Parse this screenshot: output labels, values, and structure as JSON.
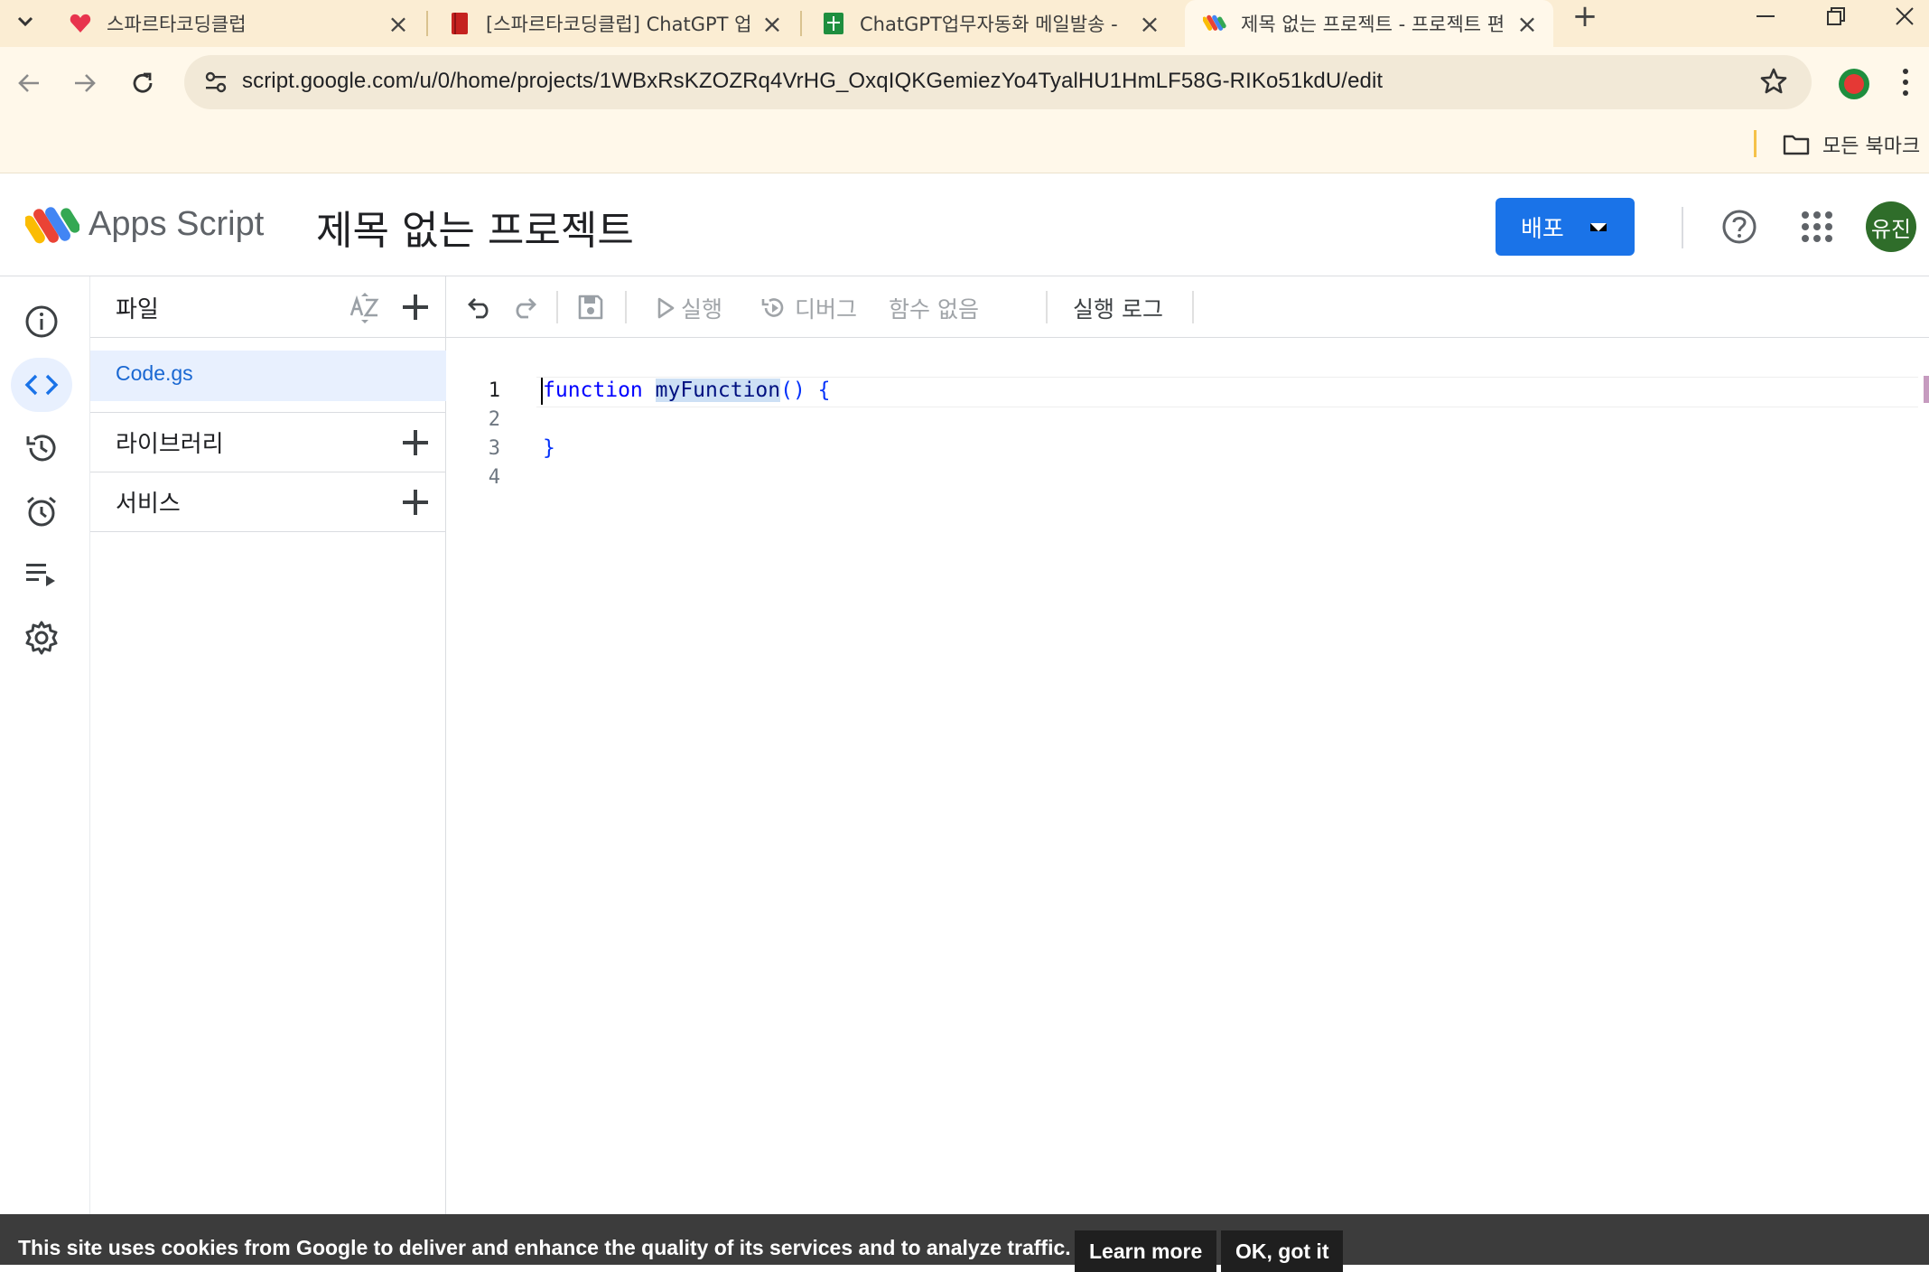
{
  "browser": {
    "tabs": [
      {
        "title": "스파르타코딩클럽",
        "favicon": "sparta-heart-icon"
      },
      {
        "title": "[스파르타코딩클럽] ChatGPT 업",
        "favicon": "book-icon"
      },
      {
        "title": "ChatGPT업무자동화 메일발송 -",
        "favicon": "sheets-icon"
      },
      {
        "title": "제목 없는 프로젝트 - 프로젝트 편",
        "favicon": "apps-script-icon"
      }
    ],
    "url": "script.google.com/u/0/home/projects/1WBxRsKZOZRq4VrHG_OxqIQKGemiezYo4TyalHU1HmLF58G-RIKo51kdU/edit",
    "bookmarks_folder": "모든 북마크"
  },
  "header": {
    "app_name": "Apps Script",
    "project_title": "제목 없는 프로젝트",
    "deploy_label": "배포",
    "avatar_text": "유진"
  },
  "files_panel": {
    "title": "파일",
    "files": [
      {
        "name": "Code.gs"
      }
    ],
    "libraries_label": "라이브러리",
    "services_label": "서비스"
  },
  "editor_toolbar": {
    "run_label": "실행",
    "debug_label": "디버그",
    "function_select": "함수 없음",
    "execution_log_label": "실행 로그"
  },
  "editor": {
    "line_numbers": [
      "1",
      "2",
      "3",
      "4"
    ],
    "lines": {
      "l1_keyword": "function",
      "l1_name": "myFunction",
      "l1_rest": "() {",
      "l3": "}"
    }
  },
  "cookie_banner": {
    "message": "This site uses cookies from Google to deliver and enhance the quality of its services and to analyze traffic.",
    "learn_more": "Learn more",
    "ok": "OK, got it"
  },
  "colors": {
    "accent": "#1a73e8",
    "selection": "#e8f0fe",
    "browser_frame": "#fbedd3",
    "cookie_bar": "#3c3c3c"
  }
}
